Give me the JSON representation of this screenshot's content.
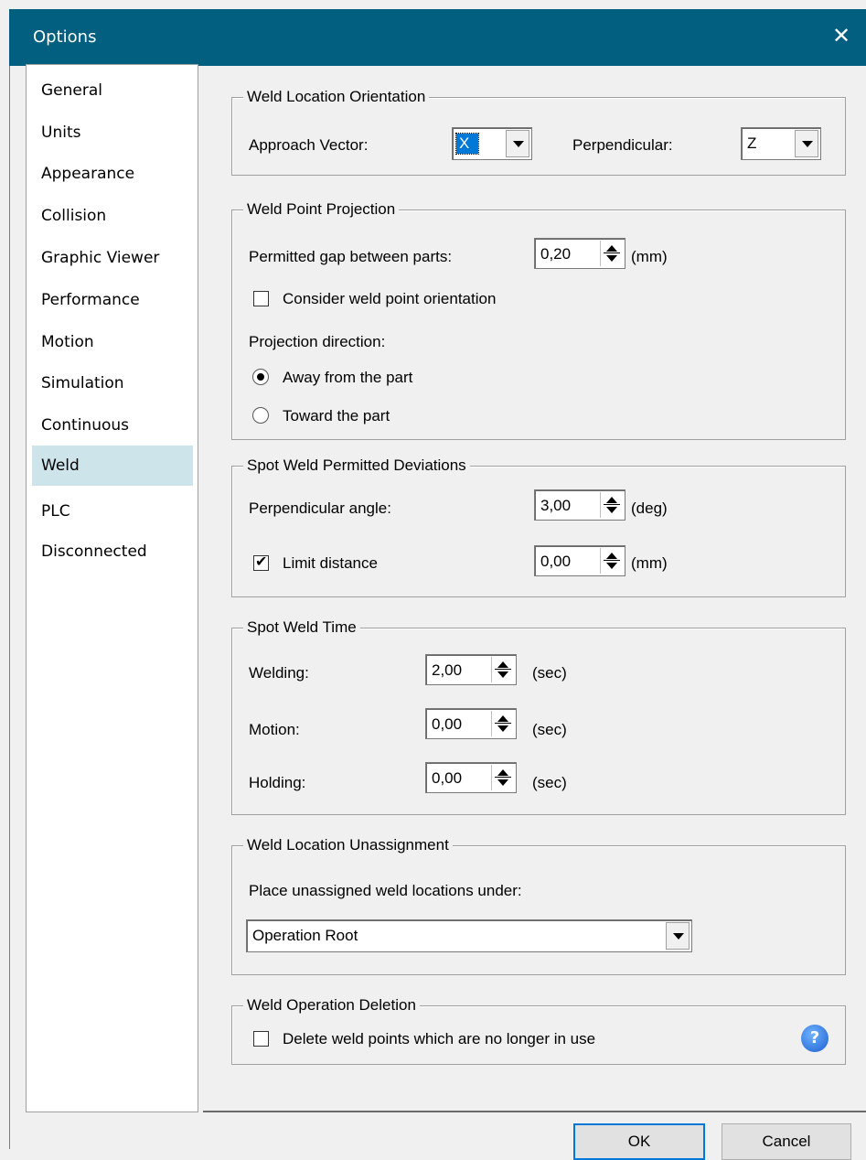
{
  "window": {
    "title": "Options",
    "close_glyph": "✕"
  },
  "sidebar": {
    "items": [
      {
        "label": "General"
      },
      {
        "label": "Units"
      },
      {
        "label": "Appearance"
      },
      {
        "label": "Collision"
      },
      {
        "label": "Graphic Viewer"
      },
      {
        "label": "Performance"
      },
      {
        "label": "Motion"
      },
      {
        "label": "Simulation"
      },
      {
        "label": "Continuous"
      },
      {
        "label": "Weld"
      },
      {
        "label": "PLC"
      },
      {
        "label": "Disconnected"
      }
    ],
    "selected": "Weld"
  },
  "weld_location_orientation": {
    "title": "Weld Location Orientation",
    "approach_label": "Approach Vector:",
    "approach_value": "X",
    "perpendicular_label": "Perpendicular:",
    "perpendicular_value": "Z"
  },
  "weld_point_projection": {
    "title": "Weld Point Projection",
    "gap_label": "Permitted gap between parts:",
    "gap_value": "0,20",
    "gap_unit": "(mm)",
    "consider_label": "Consider weld point orientation",
    "consider_checked": false,
    "direction_label": "Projection direction:",
    "away_label": "Away from the part",
    "toward_label": "Toward the part",
    "direction_selected": "away"
  },
  "spot_weld_deviations": {
    "title": "Spot Weld Permitted Deviations",
    "angle_label": "Perpendicular angle:",
    "angle_value": "3,00",
    "angle_unit": "(deg)",
    "limit_label": "Limit distance",
    "limit_checked": true,
    "limit_value": "0,00",
    "limit_unit": "(mm)"
  },
  "spot_weld_time": {
    "title": "Spot Weld Time",
    "welding_label": "Welding:",
    "welding_value": "2,00",
    "motion_label": "Motion:",
    "motion_value": "0,00",
    "holding_label": "Holding:",
    "holding_value": "0,00",
    "unit": "(sec)"
  },
  "weld_location_unassignment": {
    "title": "Weld Location Unassignment",
    "place_label": "Place unassigned weld locations under:",
    "place_value": "Operation Root"
  },
  "weld_operation_deletion": {
    "title": "Weld Operation Deletion",
    "delete_label": "Delete weld points which are no longer in use",
    "delete_checked": false,
    "help_glyph": "?"
  },
  "footer": {
    "ok_label": "OK",
    "cancel_label": "Cancel"
  }
}
